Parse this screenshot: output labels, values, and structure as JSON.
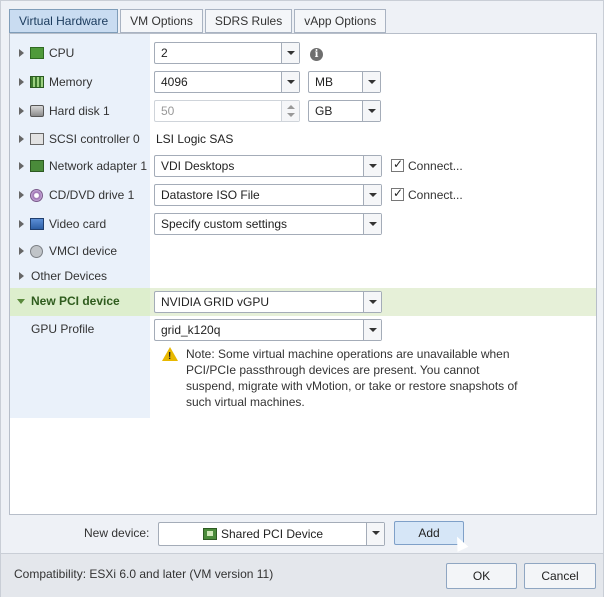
{
  "tabs": [
    {
      "label": "Virtual Hardware",
      "active": true
    },
    {
      "label": "VM Options"
    },
    {
      "label": "SDRS Rules"
    },
    {
      "label": "vApp Options"
    }
  ],
  "devices": {
    "cpu": {
      "label": "CPU",
      "value": "2",
      "icon": "cpu-icon"
    },
    "memory": {
      "label": "Memory",
      "value": "4096",
      "unit": "MB",
      "icon": "memory-icon"
    },
    "hard_disk": {
      "label": "Hard disk 1",
      "value": "50",
      "unit": "GB",
      "icon": "hard-disk-icon"
    },
    "scsi": {
      "label": "SCSI controller 0",
      "value": "LSI Logic SAS",
      "icon": "scsi-controller-icon"
    },
    "network": {
      "label": "Network adapter 1",
      "value": "VDI Desktops",
      "connect_label": "Connect...",
      "connected": true,
      "icon": "network-adapter-icon"
    },
    "cddvd": {
      "label": "CD/DVD drive 1",
      "value": "Datastore ISO File",
      "connect_label": "Connect...",
      "connected": true,
      "icon": "cd-dvd-icon"
    },
    "video": {
      "label": "Video card",
      "value": "Specify custom settings",
      "icon": "video-card-icon"
    },
    "vmci": {
      "label": "VMCI device",
      "icon": "vmci-device-icon"
    },
    "other": {
      "label": "Other Devices"
    },
    "pci": {
      "label": "New PCI device",
      "value": "NVIDIA GRID vGPU"
    },
    "gpu_profile": {
      "label": "GPU Profile",
      "value": "grid_k120q"
    }
  },
  "warning": {
    "text": "Note: Some virtual machine operations are unavailable when PCI/PCIe passthrough devices are present. You cannot suspend, migrate with vMotion, or take or restore snapshots of such virtual machines.",
    "icon": "warning-icon"
  },
  "new_device": {
    "label": "New device:",
    "value": "Shared PCI Device",
    "add_label": "Add"
  },
  "footer": {
    "compatibility": "Compatibility: ESXi 6.0 and later (VM version 11)",
    "ok_label": "OK",
    "cancel_label": "Cancel"
  },
  "colors": {
    "active_tab": "#c9dcf1",
    "label_column": "#eaf1fa",
    "highlight_row": "#ddeecd",
    "warning": "#e8b800"
  }
}
